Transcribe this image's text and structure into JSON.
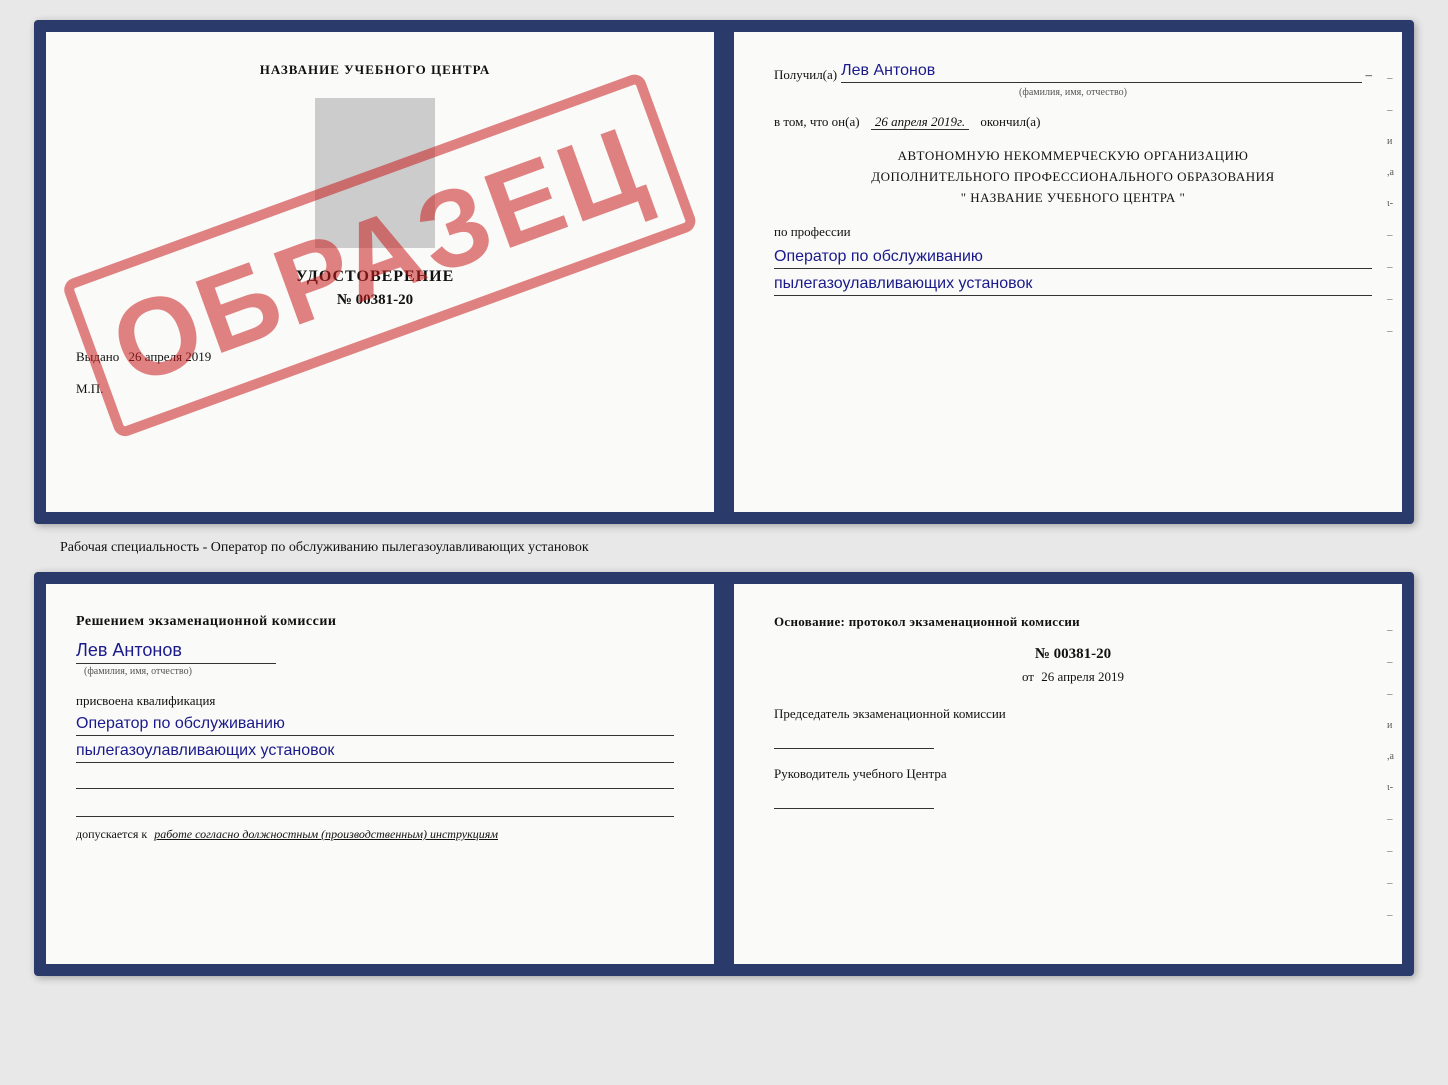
{
  "doc1": {
    "left": {
      "school_name": "НАЗВАНИЕ УЧЕБНОГО ЦЕНТРА",
      "stamp": "ОБРАЗЕЦ",
      "cert_title": "УДОСТОВЕРЕНИЕ",
      "cert_number": "№ 00381-20",
      "issued_label": "Выдано",
      "issued_date": "26 апреля 2019",
      "mp_label": "М.П."
    },
    "right": {
      "received_label": "Получил(а)",
      "recipient_name": "Лев Антонов",
      "fio_subtitle": "(фамилия, имя, отчество)",
      "completed_prefix": "в том, что он(а)",
      "completed_date": "26 апреля 2019г.",
      "completed_suffix": "окончил(а)",
      "org_line1": "АВТОНОМНУЮ НЕКОММЕРЧЕСКУЮ ОРГАНИЗАЦИЮ",
      "org_line2": "ДОПОЛНИТЕЛЬНОГО ПРОФЕССИОНАЛЬНОГО ОБРАЗОВАНИЯ",
      "org_line3": "\"  НАЗВАНИЕ УЧЕБНОГО ЦЕНТРА  \"",
      "profession_label": "по профессии",
      "profession_line1": "Оператор по обслуживанию",
      "profession_line2": "пылегазоулавливающих установок"
    }
  },
  "middle_text": "Рабочая специальность - Оператор по обслуживанию пылегазоулавливающих установок",
  "doc2": {
    "left": {
      "decision_text": "Решением экзаменационной комиссии",
      "person_name": "Лев Антонов",
      "fio_subtitle": "(фамилия, имя, отчество)",
      "assigned_label": "присвоена квалификация",
      "qual_line1": "Оператор по обслуживанию",
      "qual_line2": "пылегазоулавливающих установок",
      "допускается_prefix": "допускается к",
      "допускается_italic": "работе согласно должностным (производственным) инструкциям"
    },
    "right": {
      "basis_text": "Основание: протокол экзаменационной комиссии",
      "protocol_number": "№  00381-20",
      "protocol_date_prefix": "от",
      "protocol_date": "26 апреля 2019",
      "chairman_label": "Председатель экзаменационной комиссии",
      "director_label": "Руководитель учебного Центра"
    }
  }
}
